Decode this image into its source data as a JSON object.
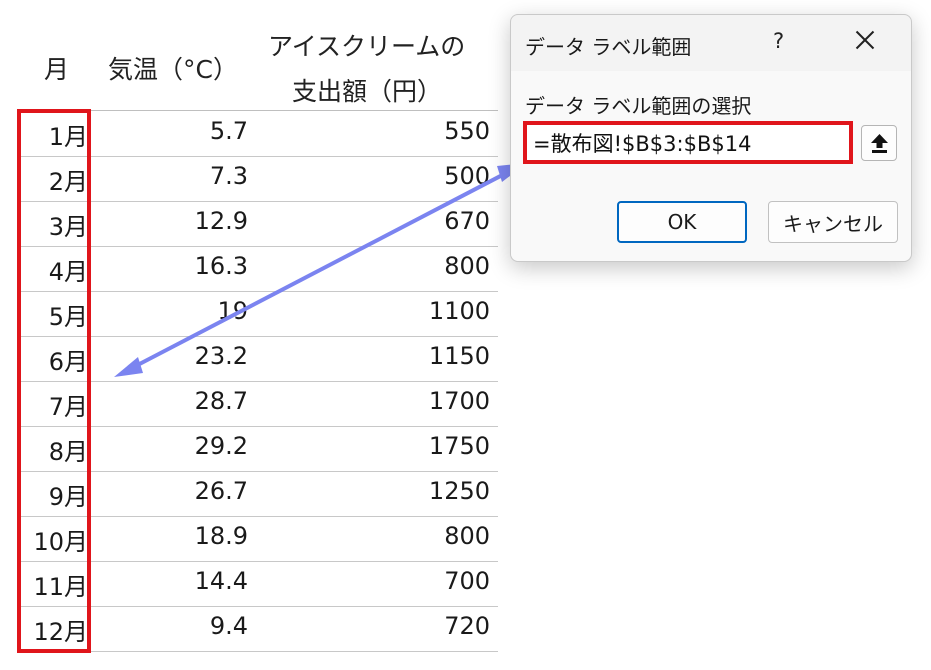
{
  "table": {
    "headers": {
      "month": "月",
      "temp": "気温（°C）",
      "ice_line1": "アイスクリームの",
      "ice_line2": "支出額（円）"
    },
    "rows": [
      {
        "month": "1月",
        "temp": "5.7",
        "ice": "550"
      },
      {
        "month": "2月",
        "temp": "7.3",
        "ice": "500"
      },
      {
        "month": "3月",
        "temp": "12.9",
        "ice": "670"
      },
      {
        "month": "4月",
        "temp": "16.3",
        "ice": "800"
      },
      {
        "month": "5月",
        "temp": "19",
        "ice": "1100"
      },
      {
        "month": "6月",
        "temp": "23.2",
        "ice": "1150"
      },
      {
        "month": "7月",
        "temp": "28.7",
        "ice": "1700"
      },
      {
        "month": "8月",
        "temp": "29.2",
        "ice": "1750"
      },
      {
        "month": "9月",
        "temp": "26.7",
        "ice": "1250"
      },
      {
        "month": "10月",
        "temp": "18.9",
        "ice": "800"
      },
      {
        "month": "11月",
        "temp": "14.4",
        "ice": "700"
      },
      {
        "month": "12月",
        "temp": "9.4",
        "ice": "720"
      }
    ]
  },
  "dialog": {
    "title": "データ ラベル範囲",
    "help": "?",
    "label": "データ ラベル範囲の選択",
    "range_value": "=散布図!$B$3:$B$14",
    "ok_label": "OK",
    "cancel_label": "キャンセル"
  },
  "colors": {
    "highlight": "#e0151b",
    "arrow": "#7b84f0",
    "ok_border": "#0067c0"
  }
}
